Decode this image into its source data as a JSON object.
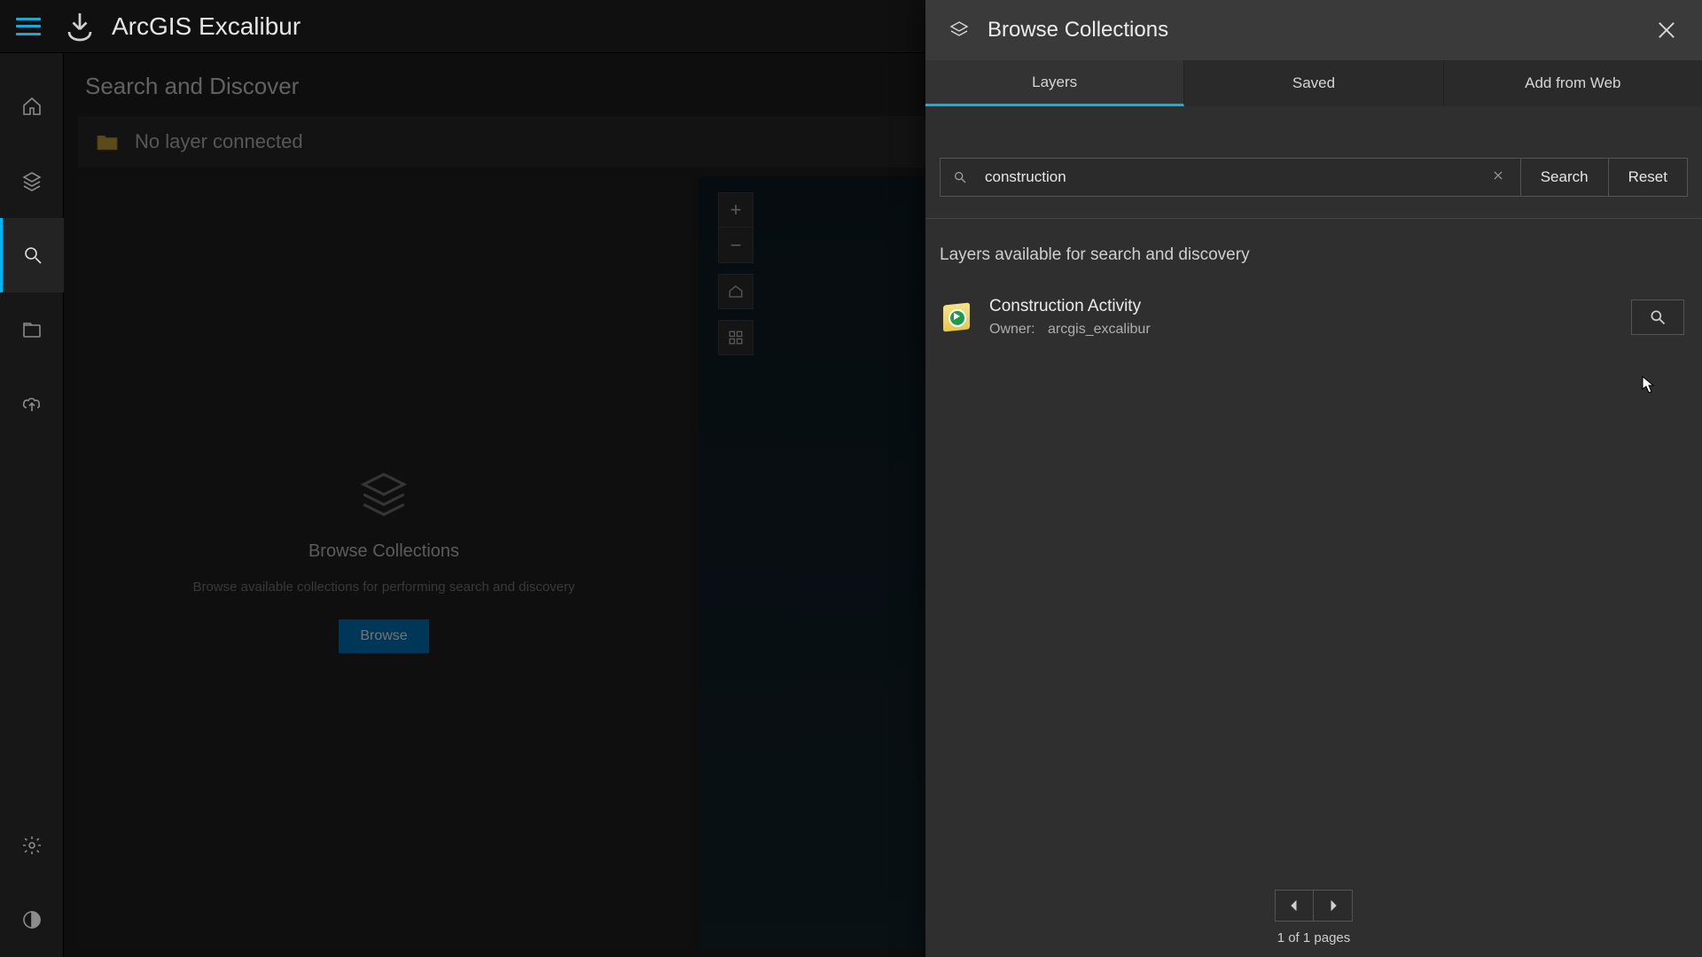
{
  "app": {
    "title": "ArcGIS Excalibur"
  },
  "page": {
    "title": "Search and Discover"
  },
  "layerbar": {
    "status": "No layer connected"
  },
  "collections_card": {
    "heading": "Browse Collections",
    "description": "Browse available collections for performing search and discovery",
    "browse_label": "Browse"
  },
  "maptools": {
    "zoom_in": "+",
    "zoom_out": "−"
  },
  "panel": {
    "title": "Browse Collections",
    "tabs": {
      "layers": "Layers",
      "saved": "Saved",
      "add_from_web": "Add from Web"
    },
    "search": {
      "value": "construction",
      "search_label": "Search",
      "reset_label": "Reset"
    },
    "section_label": "Layers available for search and discovery",
    "results": [
      {
        "title": "Construction Activity",
        "owner_label": "Owner:",
        "owner": "arcgis_excalibur"
      }
    ],
    "pager": {
      "text": "1 of 1 pages"
    }
  },
  "nav_icons": {
    "home": "home-icon",
    "layers": "layers-icon",
    "search": "search-icon",
    "folder": "folder-icon",
    "upload": "upload-icon",
    "settings": "gear-icon",
    "theme": "contrast-icon"
  }
}
